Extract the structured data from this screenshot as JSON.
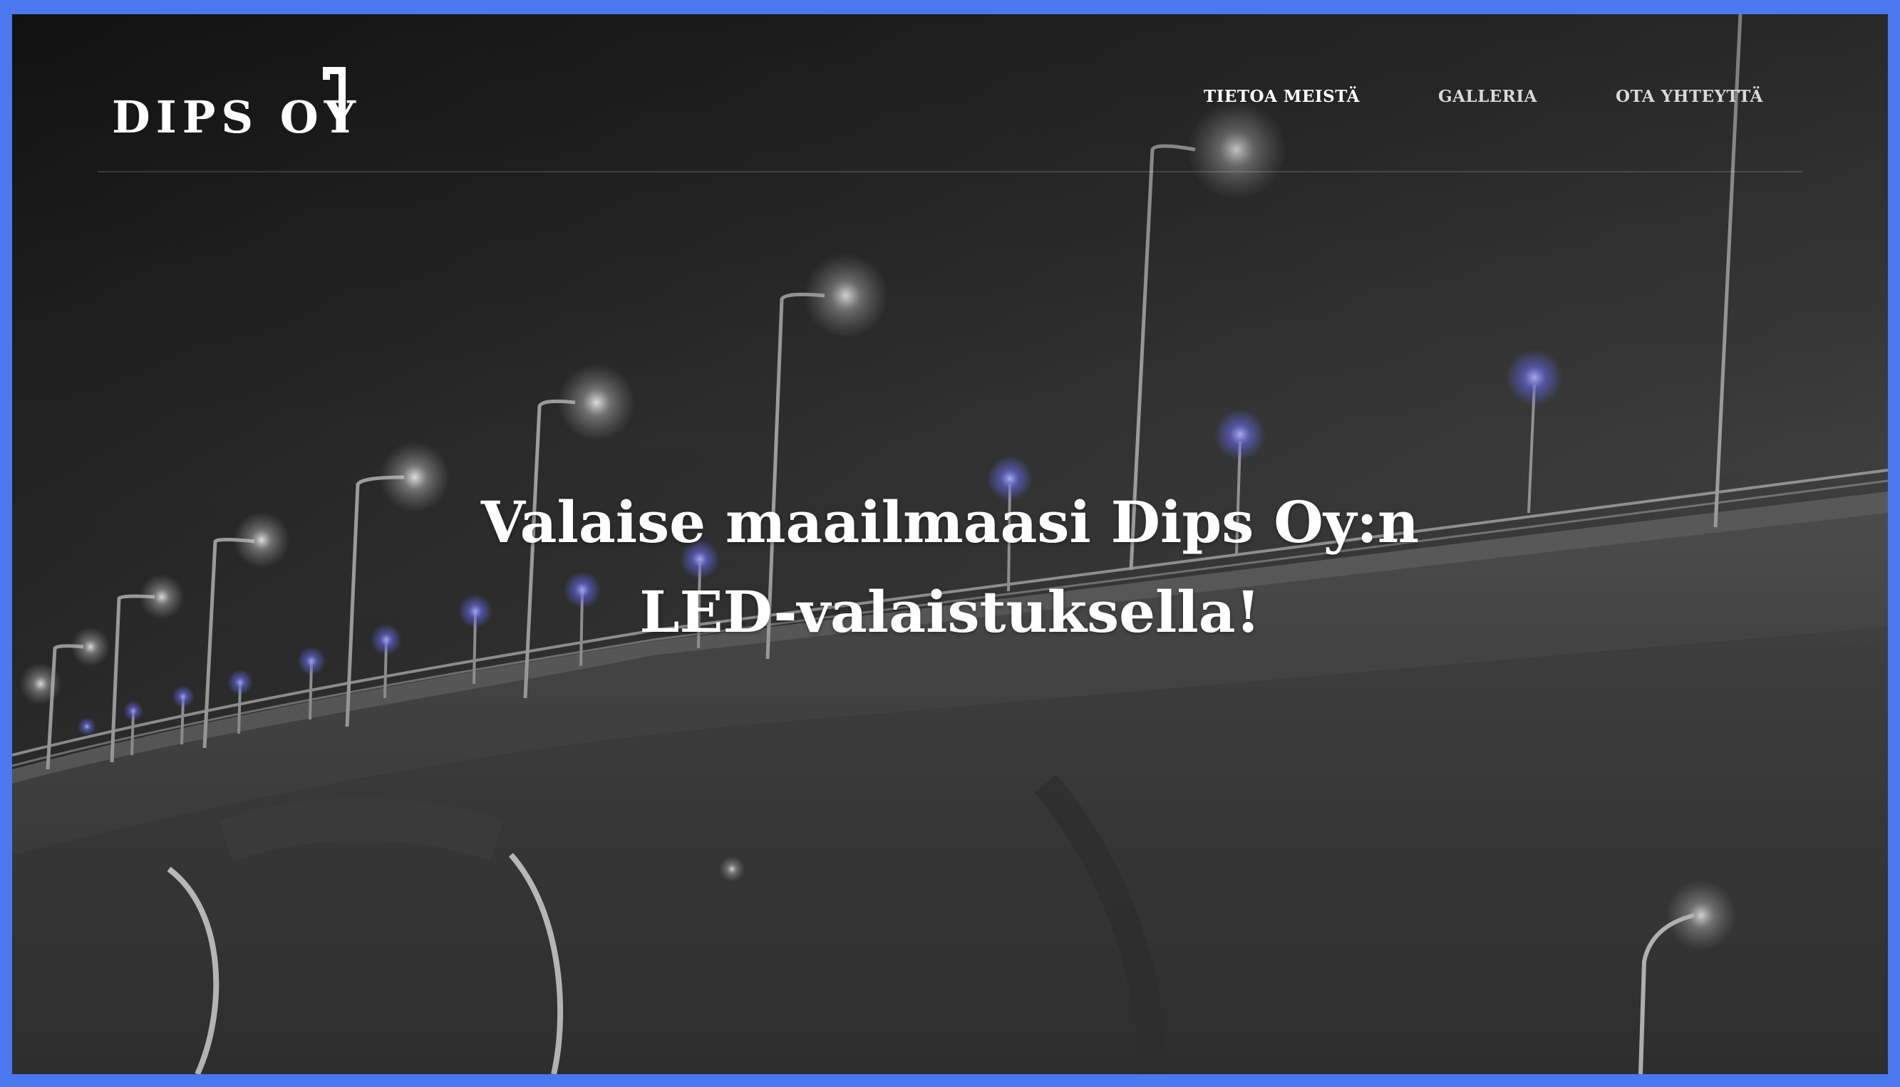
{
  "brand": {
    "name": "DIPS OY"
  },
  "nav": {
    "items": [
      {
        "label": "TIETOA MEISTÄ"
      },
      {
        "label": "GALLERIA"
      },
      {
        "label": "OTA YHTEYTTÄ"
      }
    ]
  },
  "hero": {
    "line1": "Valaise maailmaasi Dips Oy:n",
    "line2": "LED-valaistuksella!"
  },
  "colors": {
    "frame_border": "#4a78ee",
    "text": "#ffffff",
    "lamp_blue": "#6a6cff"
  }
}
